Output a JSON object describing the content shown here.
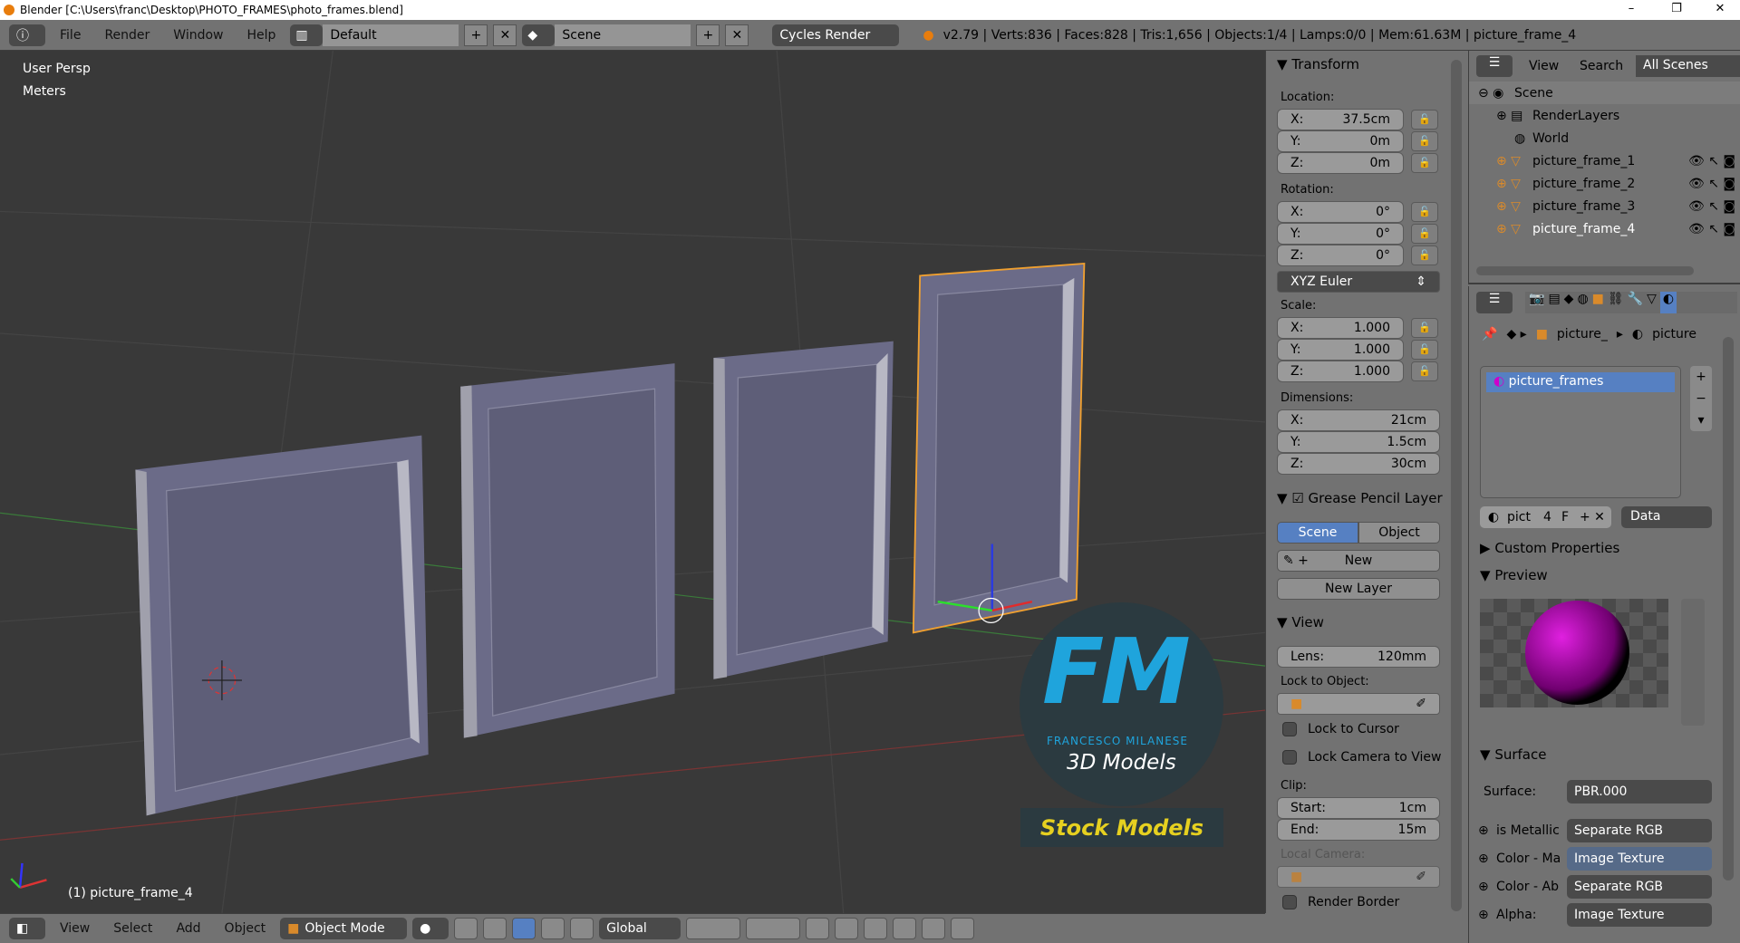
{
  "window": {
    "title": "Blender [C:\\Users\\franc\\Desktop\\PHOTO_FRAMES\\photo_frames.blend]",
    "minimize": "–",
    "maximize": "❐",
    "close": "✕"
  },
  "topbar": {
    "menus": [
      "File",
      "Render",
      "Window",
      "Help"
    ],
    "screen_layout": "Default",
    "scene": "Scene",
    "render_engine": "Cycles Render",
    "stats": "v2.79 | Verts:836 | Faces:828 | Tris:1,656 | Objects:1/4 | Lamps:0/0 | Mem:61.63M | picture_frame_4"
  },
  "viewport": {
    "view_name": "User Persp",
    "units": "Meters",
    "active_object": "(1) picture_frame_4",
    "watermark": {
      "logo": "FM",
      "brand": "FRANCESCO MILANESE",
      "tagline": "3D Models",
      "banner": "Stock Models"
    },
    "selection_color": "#f0a030"
  },
  "npanel": {
    "transform": {
      "title": "Transform",
      "location_label": "Location:",
      "location": [
        {
          "axis": "X:",
          "value": "37.5cm"
        },
        {
          "axis": "Y:",
          "value": "0m"
        },
        {
          "axis": "Z:",
          "value": "0m"
        }
      ],
      "rotation_label": "Rotation:",
      "rotation": [
        {
          "axis": "X:",
          "value": "0°"
        },
        {
          "axis": "Y:",
          "value": "0°"
        },
        {
          "axis": "Z:",
          "value": "0°"
        }
      ],
      "rotation_mode": "XYZ Euler",
      "scale_label": "Scale:",
      "scale": [
        {
          "axis": "X:",
          "value": "1.000"
        },
        {
          "axis": "Y:",
          "value": "1.000"
        },
        {
          "axis": "Z:",
          "value": "1.000"
        }
      ],
      "dimensions_label": "Dimensions:",
      "dimensions": [
        {
          "axis": "X:",
          "value": "21cm"
        },
        {
          "axis": "Y:",
          "value": "1.5cm"
        },
        {
          "axis": "Z:",
          "value": "30cm"
        }
      ]
    },
    "grease_pencil": {
      "title": "Grease Pencil Layer",
      "tab_scene": "Scene",
      "tab_object": "Object",
      "new": "New",
      "new_layer": "New Layer"
    },
    "view": {
      "title": "View",
      "lens_label": "Lens:",
      "lens": "120mm",
      "lock_object_label": "Lock to Object:",
      "lock_cursor": "Lock to Cursor",
      "lock_camera": "Lock Camera to View",
      "clip_label": "Clip:",
      "clip_start_label": "Start:",
      "clip_start": "1cm",
      "clip_end_label": "End:",
      "clip_end": "15m",
      "local_camera_label": "Local Camera:",
      "render_border": "Render Border"
    }
  },
  "outliner": {
    "view": "View",
    "search": "Search",
    "filter": "All Scenes",
    "items": [
      {
        "label": "Scene"
      },
      {
        "label": "RenderLayers"
      },
      {
        "label": "World"
      },
      {
        "label": "picture_frame_1"
      },
      {
        "label": "picture_frame_2"
      },
      {
        "label": "picture_frame_3"
      },
      {
        "label": "picture_frame_4"
      }
    ]
  },
  "properties": {
    "breadcrumb": [
      "picture_",
      "picture"
    ],
    "material_slots": [
      "picture_frames"
    ],
    "material_name": "pict",
    "users": "4",
    "fake": "F",
    "link": "Data",
    "custom_properties": "Custom Properties",
    "preview": "Preview",
    "surface": {
      "title": "Surface",
      "surface_label": "Surface:",
      "surface_value": "PBR.000",
      "inputs": [
        {
          "label": "is Metallic",
          "value": "Separate RGB"
        },
        {
          "label": "Color - Ma",
          "value": "Image Texture"
        },
        {
          "label": "Color - Ab",
          "value": "Separate RGB"
        },
        {
          "label": "Alpha:",
          "value": "Image Texture"
        }
      ]
    }
  },
  "bottombar": {
    "menus": [
      "View",
      "Select",
      "Add",
      "Object"
    ],
    "mode": "Object Mode",
    "orientation": "Global"
  }
}
